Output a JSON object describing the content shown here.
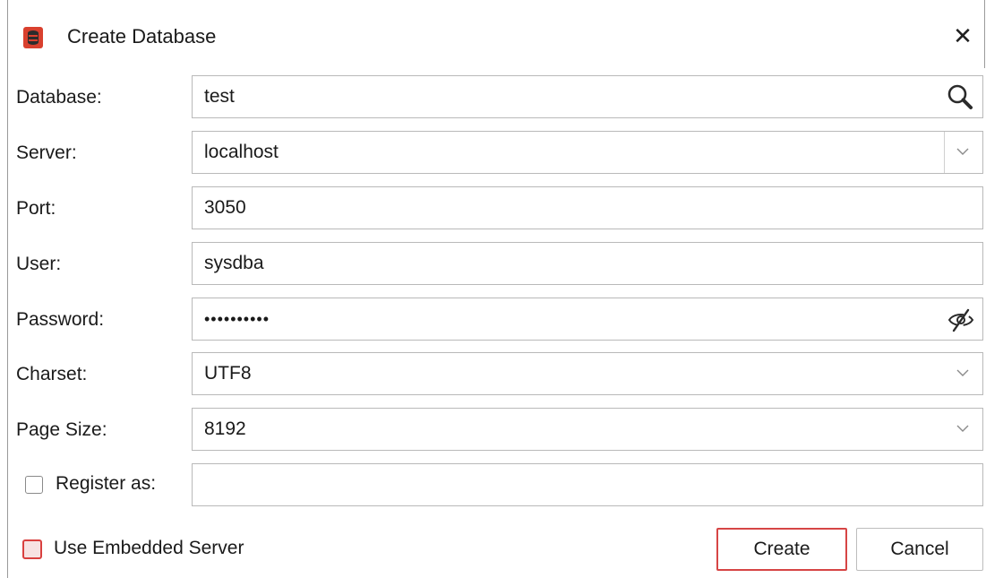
{
  "window": {
    "title": "Create Database",
    "app_icon": "database-app-icon",
    "close_icon": "close-icon",
    "close_glyph": "✕"
  },
  "form": {
    "database": {
      "label": "Database:",
      "value": "test",
      "icon": "search-icon"
    },
    "server": {
      "label": "Server:",
      "value": "localhost",
      "icon": "chevron-down-icon"
    },
    "port": {
      "label": "Port:",
      "value": "3050"
    },
    "user": {
      "label": "User:",
      "value": "sysdba"
    },
    "password": {
      "label": "Password:",
      "value": "••••••••••",
      "icon": "eye-slash-icon"
    },
    "charset": {
      "label": "Charset:",
      "value": "UTF8",
      "icon": "chevron-down-icon"
    },
    "page_size": {
      "label": "Page Size:",
      "value": "8192",
      "icon": "chevron-down-icon"
    },
    "register_as": {
      "label": "Register as:",
      "checked": false,
      "value": ""
    }
  },
  "footer": {
    "use_embedded_server": {
      "label": "Use Embedded Server",
      "checked": false
    },
    "create_label": "Create",
    "cancel_label": "Cancel"
  },
  "colors": {
    "accent": "#d64545",
    "border": "#b9b9b9",
    "app_icon": "#d9402e"
  }
}
